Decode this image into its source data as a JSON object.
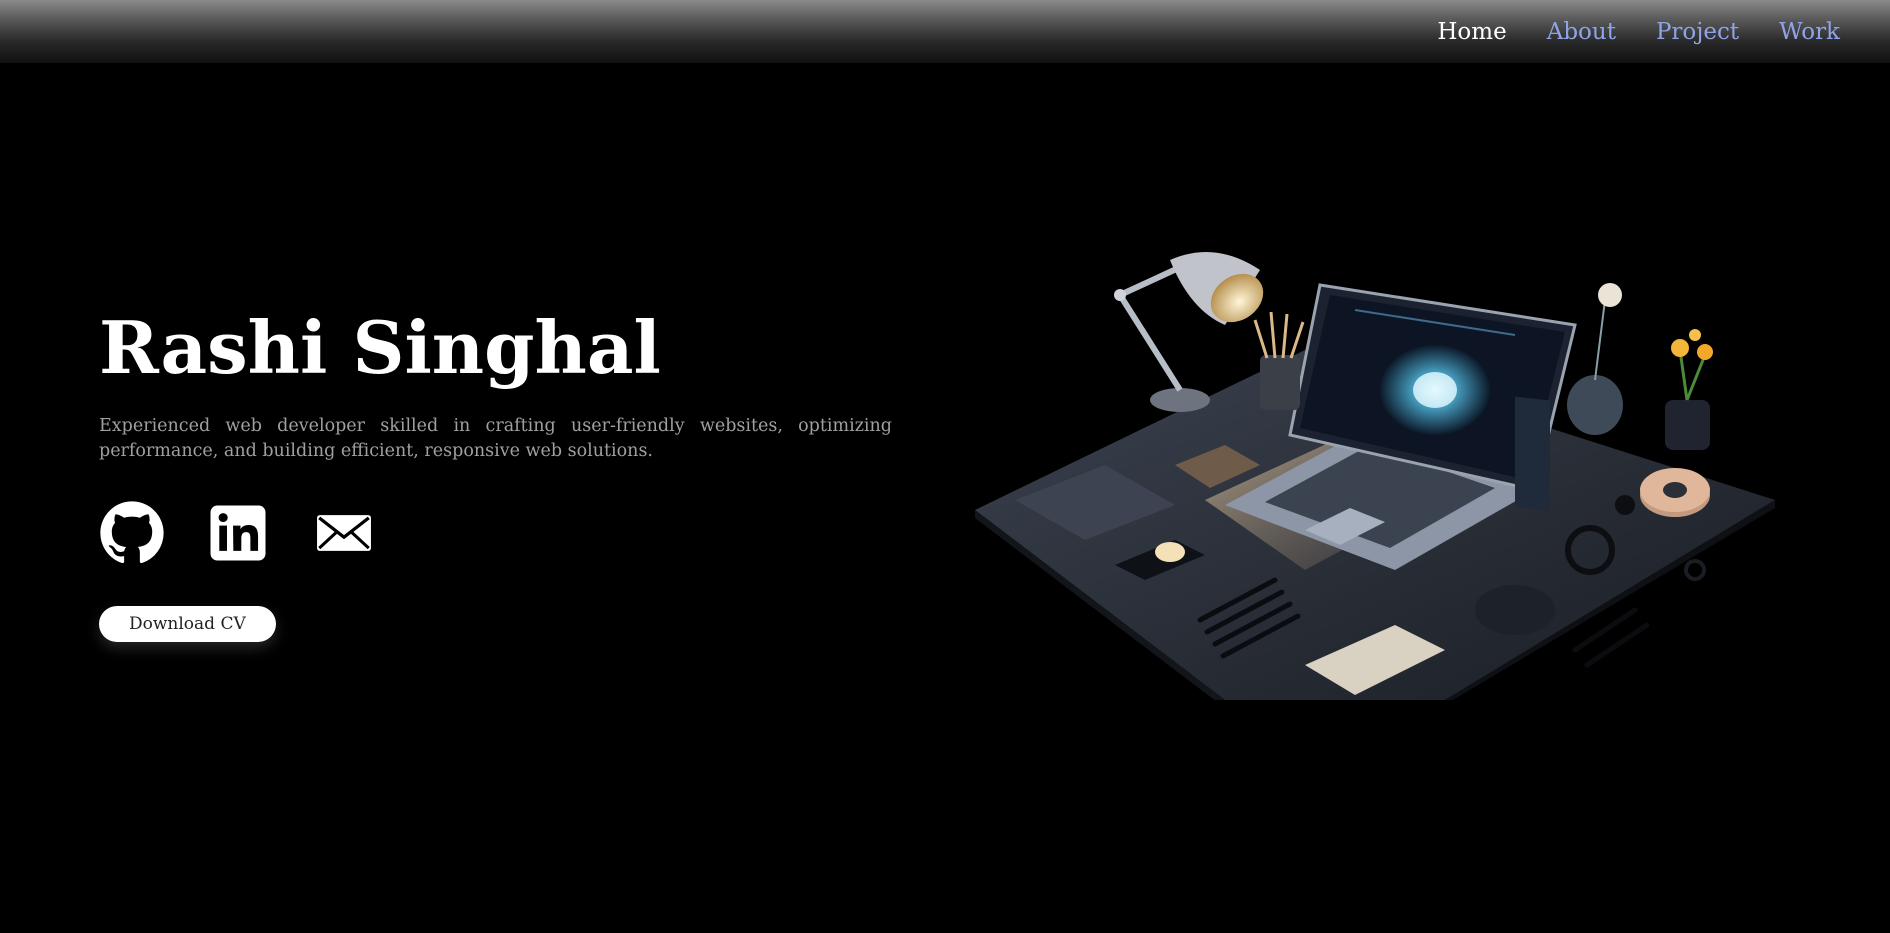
{
  "nav": {
    "items": [
      {
        "label": "Home",
        "active": true
      },
      {
        "label": "About",
        "active": false
      },
      {
        "label": "Project",
        "active": false
      },
      {
        "label": "Work",
        "active": false
      }
    ]
  },
  "hero": {
    "name": "Rashi Singhal",
    "description": "Experienced web developer skilled in crafting user-friendly websites, optimizing performance, and building efficient, responsive web solutions.",
    "cv_button_label": "Download CV",
    "social": [
      {
        "icon": "github-icon"
      },
      {
        "icon": "linkedin-icon"
      },
      {
        "icon": "mail-icon"
      }
    ],
    "illustration": "workspace-desk-illustration"
  },
  "colors": {
    "background": "#000000",
    "nav_link": "#8fa4e8",
    "nav_active": "#ffffff",
    "description_text": "#a0a0a0",
    "button_bg": "#ffffff"
  }
}
